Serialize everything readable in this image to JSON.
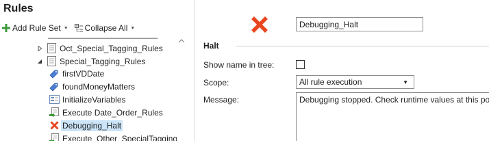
{
  "left_panel": {
    "title": "Rules",
    "toolbar": {
      "add_rule_set_label": "Add Rule Set",
      "collapse_all_label": "Collapse All"
    },
    "tree": {
      "items": [
        {
          "label": "Oct_Special_Tagging_Rules",
          "icon": "document-icon",
          "expander": "collapsed"
        },
        {
          "label": "Special_Tagging_Rules",
          "icon": "document-icon",
          "expander": "expanded"
        },
        {
          "label": "firstVDDate",
          "icon": "tag-icon"
        },
        {
          "label": "foundMoneyMatters",
          "icon": "tag-icon"
        },
        {
          "label": "InitializeVariables",
          "icon": "variables-icon"
        },
        {
          "label": "Execute Date_Order_Rules",
          "icon": "execute-icon"
        },
        {
          "label": "Debugging_Halt",
          "icon": "halt-icon",
          "selected": true
        },
        {
          "label": "Execute_Other_SpecialTagging",
          "icon": "execute-icon"
        }
      ]
    }
  },
  "right_panel": {
    "name_value": "Debugging_Halt",
    "section_title": "Halt",
    "show_name_label": "Show name in tree:",
    "show_name_checked": false,
    "scope_label": "Scope:",
    "scope_value": "All rule execution",
    "message_label": "Message:",
    "message_value": "Debugging stopped. Check runtime values at this point."
  },
  "colors": {
    "halt_red": "#e8461e",
    "add_green": "#3c9a3c",
    "tag_blue": "#4a7fd4",
    "selection": "#cce4f7"
  }
}
